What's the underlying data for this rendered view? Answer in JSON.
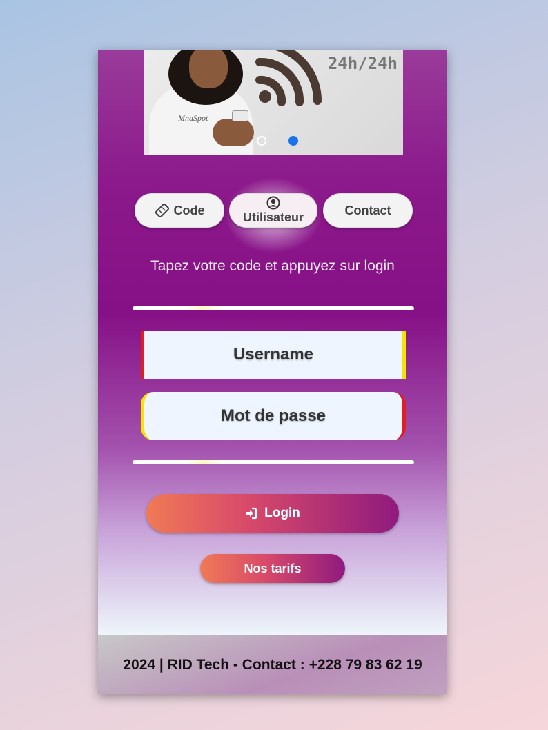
{
  "banner": {
    "text": "24h/24h",
    "logo_text": "MnaSpot",
    "carousel_active_index": 1,
    "carousel_count": 2
  },
  "tabs": [
    {
      "label": "Code",
      "icon": "ticket-icon"
    },
    {
      "label": "Utilisateur",
      "icon": "user-circle-icon"
    },
    {
      "label": "Contact",
      "icon": ""
    }
  ],
  "instruction": "Tapez votre code et appuyez sur login",
  "form": {
    "username_placeholder": "Username",
    "password_placeholder": "Mot de passe",
    "login_label": "Login",
    "login_icon": "sign-in-icon"
  },
  "tarifs_label": "Nos tarifs",
  "footer": "2024 | RID Tech - Contact : +228 79 83 62 19",
  "colors": {
    "accent_start": "#f07a55",
    "accent_end": "#8f1a7e",
    "card_purple": "#861086",
    "active_dot": "#1a73e8"
  }
}
